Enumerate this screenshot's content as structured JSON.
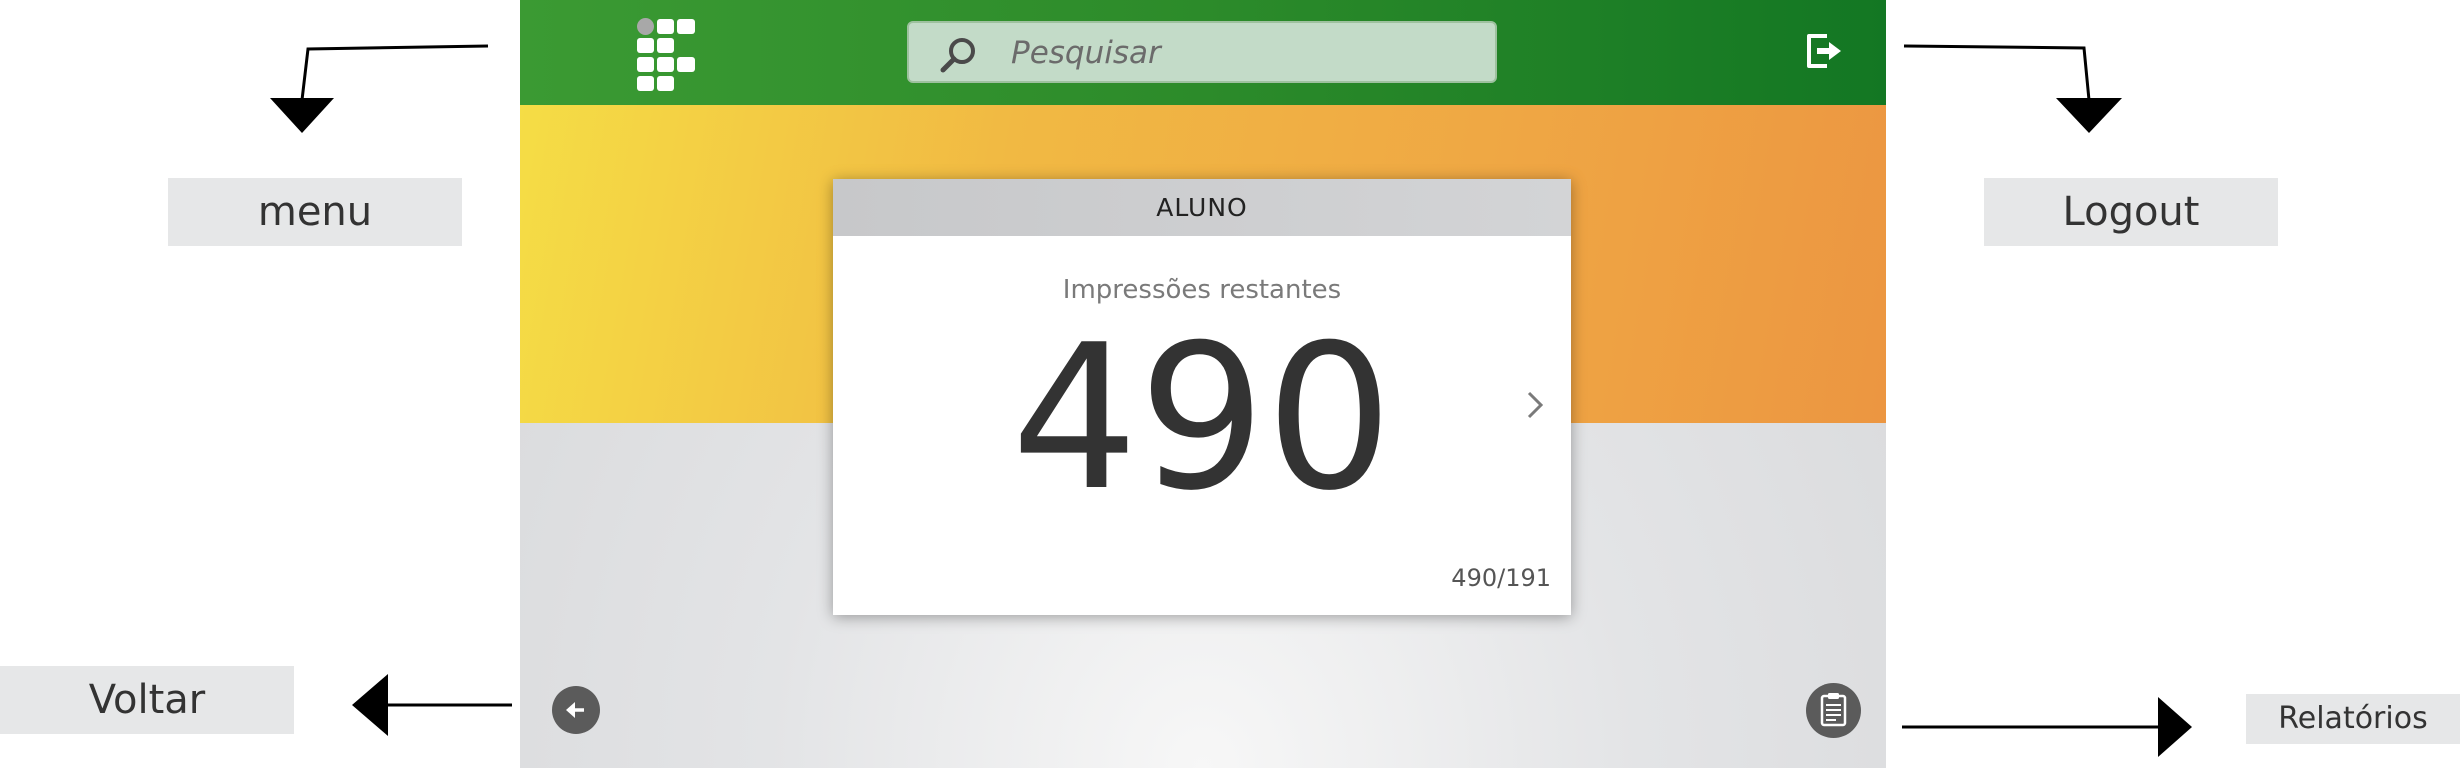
{
  "header": {
    "search_placeholder": "Pesquisar"
  },
  "card": {
    "title": "ALUNO",
    "subtitle": "Impressões restantes",
    "count": "490",
    "ratio": "490/191"
  },
  "annotations": {
    "menu": "menu",
    "logout": "Logout",
    "voltar": "Voltar",
    "relatorios": "Relatórios"
  },
  "colors": {
    "topbar_green": "#2c8b2a",
    "hero_yellow": "#f5dd45",
    "hero_orange": "#ec9641",
    "button_gray": "#5b5b5b"
  },
  "icons": {
    "logo": "grid-logo-icon",
    "search": "search-icon",
    "logout": "logout-icon",
    "chevron": "chevron-right-icon",
    "back": "arrow-left-icon",
    "reports": "clipboard-icon"
  }
}
